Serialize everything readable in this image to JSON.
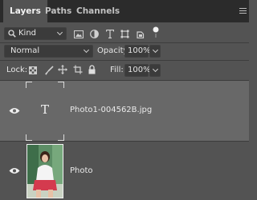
{
  "tabs": [
    {
      "label": "Layers",
      "active": true
    },
    {
      "label": "Paths",
      "active": false
    },
    {
      "label": "Channels",
      "active": false
    }
  ],
  "filter": {
    "kind_label": "Kind",
    "icons": [
      "image-filter-icon",
      "adjustment-filter-icon",
      "type-filter-icon",
      "shape-filter-icon",
      "smart-object-filter-icon",
      "filter-toggle-dot-icon"
    ]
  },
  "blend": {
    "mode": "Normal",
    "opacity_label": "Opacity:",
    "opacity_value": "100%"
  },
  "lock": {
    "label": "Lock:",
    "icons": [
      "lock-transparent-pixels-icon",
      "lock-image-pixels-icon",
      "lock-position-icon",
      "lock-artboard-icon",
      "lock-all-icon"
    ],
    "fill_label": "Fill:",
    "fill_value": "100%"
  },
  "layers": [
    {
      "name": "Photo1-004562B.jpg",
      "type": "text",
      "thumb_glyph": "T",
      "visible": true,
      "selected": true
    },
    {
      "name": "Photo",
      "type": "image",
      "visible": true,
      "selected": false
    }
  ],
  "colors": {
    "panel": "#535353",
    "tabbar": "#2b2b2b",
    "selected_layer": "#686868",
    "input": "#3b3b3b"
  }
}
